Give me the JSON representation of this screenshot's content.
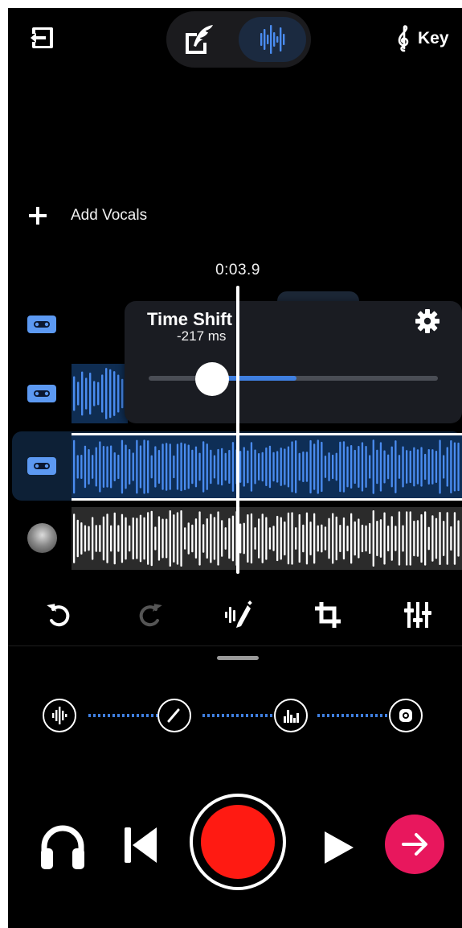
{
  "header": {
    "key_label": "Key",
    "icons": {
      "exit": "exit-icon",
      "lyrics_mode": "quill-edit-icon",
      "audio_mode": "waveform-icon",
      "key": "treble-clef-icon"
    }
  },
  "add_vocals": {
    "label": "Add Vocals",
    "icon": "plus-icon"
  },
  "playhead": {
    "time": "0:03.9"
  },
  "time_shift": {
    "title": "Time Shift",
    "value": "-217 ms",
    "icon": "gear-icon",
    "slider_fraction": 0.51
  },
  "tracks": [
    {
      "icon": "cassette-icon",
      "selected": false
    },
    {
      "icon": "cassette-icon",
      "selected": false
    },
    {
      "icon": "cassette-icon",
      "selected": true
    },
    {
      "icon": "avatar-beat",
      "selected": false
    }
  ],
  "toolbar": {
    "icons": [
      "undo-icon",
      "redo-icon",
      "magic-edit-icon",
      "crop-icon",
      "mixer-icon"
    ],
    "redo_enabled": false
  },
  "fx_chain": {
    "icons": [
      "waveform-icon",
      "slash-icon",
      "equalizer-icon",
      "reverb-icon"
    ]
  },
  "transport": {
    "icons": [
      "headphones-icon",
      "skip-previous-icon",
      "record-icon",
      "play-icon",
      "arrow-right-icon"
    ]
  },
  "colors": {
    "accent_blue": "#3f7fe0",
    "wave_blue": "#4a8cf0",
    "record_red": "#ff1a12",
    "next_pink": "#e8175d",
    "background": "#000000"
  }
}
